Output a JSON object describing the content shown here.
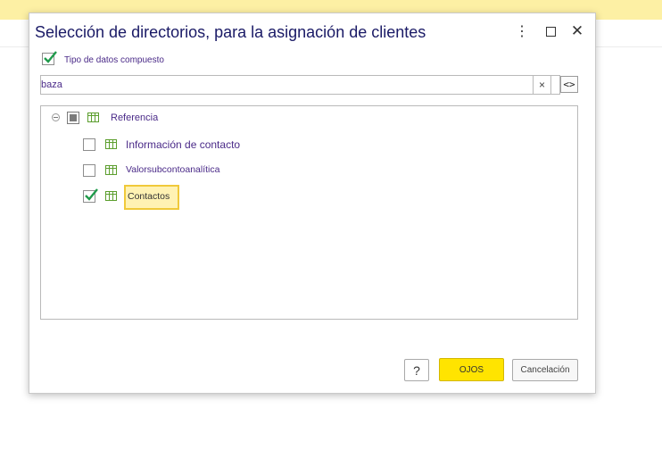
{
  "dialog": {
    "title": "Selección de directorios, para la asignación de clientes",
    "more_icon": "⋮",
    "close_icon": "✕"
  },
  "composite": {
    "checked": true,
    "label": "Tipo de datos compuesto"
  },
  "search": {
    "value": "baza",
    "clear": "×",
    "code_button": "<>"
  },
  "tree": {
    "root": {
      "label": "Referencia",
      "state": "indeterminate",
      "expanded": true
    },
    "items": [
      {
        "label": "Información de contacto",
        "checked": false
      },
      {
        "label": "Valorsubcontoanalítica",
        "checked": false
      },
      {
        "label": "Contactos",
        "checked": true,
        "selected": true
      }
    ]
  },
  "buttons": {
    "help": "?",
    "ok": "OJOS",
    "cancel": "Cancelación"
  },
  "colors": {
    "accent_yellow": "#ffe400",
    "check_green": "#1f9a4b",
    "text_purple": "#4a2a88",
    "title_navy": "#1a1a66"
  }
}
